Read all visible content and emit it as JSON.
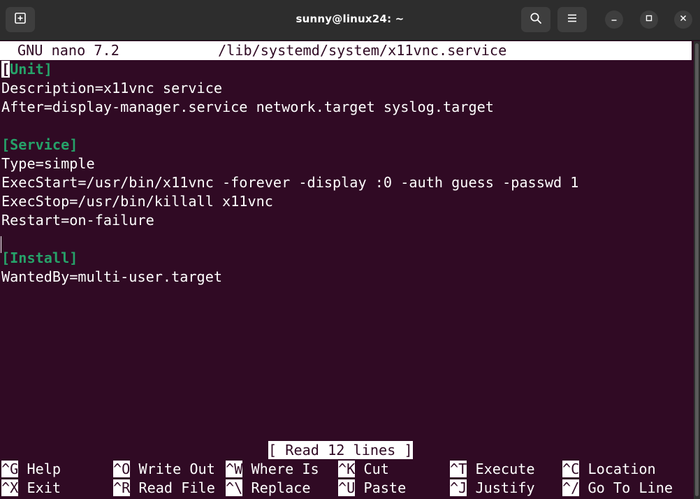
{
  "window": {
    "title": "sunny@linux24: ~",
    "buttons": {
      "new_tab_icon": "new-tab-icon",
      "search_icon": "search-icon",
      "menu_icon": "hamburger-menu-icon",
      "minimize_icon": "minimize-icon",
      "maximize_icon": "maximize-icon",
      "close_icon": "close-icon"
    }
  },
  "nano": {
    "app": "GNU nano 7.2",
    "filename": "/lib/systemd/system/x11vnc.service",
    "status": "[ Read 12 lines ]"
  },
  "file": {
    "unit_header_open": "[",
    "unit_header_rest": "Unit]",
    "description": "Description=x11vnc service",
    "after": "After=display-manager.service network.target syslog.target",
    "service_header": "[Service]",
    "type": "Type=simple",
    "exec_start": "ExecStart=/usr/bin/x11vnc -forever -display :0 -auth guess -passwd 1",
    "exec_stop": "ExecStop=/usr/bin/killall x11vnc",
    "restart": "Restart=on-failure",
    "install_header": "[Install]",
    "wanted_by": "WantedBy=multi-user.target"
  },
  "shortcuts": {
    "row1": [
      {
        "key": "^G",
        "label": "Help"
      },
      {
        "key": "^O",
        "label": "Write Out"
      },
      {
        "key": "^W",
        "label": "Where Is"
      },
      {
        "key": "^K",
        "label": "Cut"
      },
      {
        "key": "^T",
        "label": "Execute"
      },
      {
        "key": "^C",
        "label": "Location"
      }
    ],
    "row2": [
      {
        "key": "^X",
        "label": "Exit"
      },
      {
        "key": "^R",
        "label": "Read File"
      },
      {
        "key": "^\\",
        "label": "Replace"
      },
      {
        "key": "^U",
        "label": "Paste"
      },
      {
        "key": "^J",
        "label": "Justify"
      },
      {
        "key": "^/",
        "label": "Go To Line"
      }
    ]
  },
  "colors": {
    "terminal_bg": "#300a24",
    "section": "#26a269",
    "text": "#ffffff"
  }
}
